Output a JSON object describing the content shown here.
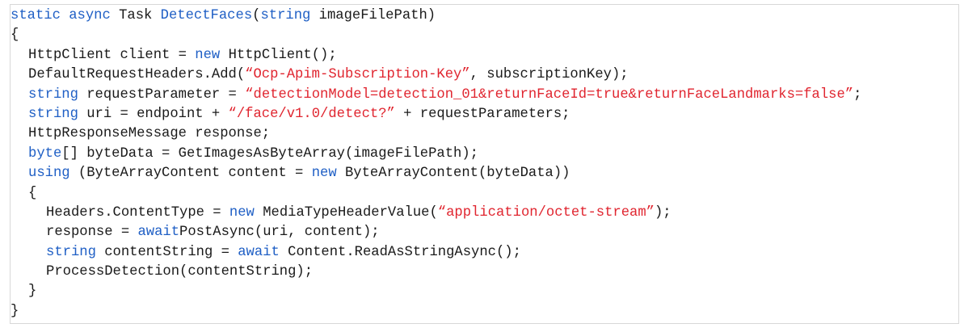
{
  "code": {
    "lines": [
      {
        "indent": 0,
        "tokens": [
          {
            "t": "static async ",
            "c": "kw"
          },
          {
            "t": "Task ",
            "c": "tx"
          },
          {
            "t": "DetectFaces",
            "c": "fn"
          },
          {
            "t": "(",
            "c": "tx"
          },
          {
            "t": "string",
            "c": "kw"
          },
          {
            "t": " imageFilePath)",
            "c": "tx"
          }
        ]
      },
      {
        "indent": 0,
        "tokens": [
          {
            "t": "{",
            "c": "tx"
          }
        ]
      },
      {
        "indent": 1,
        "tokens": [
          {
            "t": "HttpClient client = ",
            "c": "tx"
          },
          {
            "t": "new",
            "c": "kw"
          },
          {
            "t": " HttpClient();",
            "c": "tx"
          }
        ]
      },
      {
        "indent": 1,
        "tokens": [
          {
            "t": "DefaultRequestHeaders.Add(",
            "c": "tx"
          },
          {
            "t": "“Ocp-Apim-Subscription-Key”",
            "c": "str"
          },
          {
            "t": ", subscriptionKey);",
            "c": "tx"
          }
        ]
      },
      {
        "indent": 1,
        "tokens": [
          {
            "t": "string",
            "c": "kw"
          },
          {
            "t": " requestParameter = ",
            "c": "tx"
          },
          {
            "t": "“detectionModel=detection_01&returnFaceId=true&returnFaceLandmarks=false”",
            "c": "str"
          },
          {
            "t": ";",
            "c": "tx"
          }
        ]
      },
      {
        "indent": 1,
        "tokens": [
          {
            "t": "string",
            "c": "kw"
          },
          {
            "t": " uri = endpoint + ",
            "c": "tx"
          },
          {
            "t": "“/face/v1.0/detect?”",
            "c": "str"
          },
          {
            "t": " + requestParameters;",
            "c": "tx"
          }
        ]
      },
      {
        "indent": 1,
        "tokens": [
          {
            "t": "HttpResponseMessage response;",
            "c": "tx"
          }
        ]
      },
      {
        "indent": 1,
        "tokens": [
          {
            "t": "byte",
            "c": "kw"
          },
          {
            "t": "[] byteData = GetImagesAsByteArray(imageFilePath);",
            "c": "tx"
          }
        ]
      },
      {
        "indent": 1,
        "tokens": [
          {
            "t": "using",
            "c": "kw"
          },
          {
            "t": " (ByteArrayContent content = ",
            "c": "tx"
          },
          {
            "t": "new",
            "c": "kw"
          },
          {
            "t": " ByteArrayContent(byteData))",
            "c": "tx"
          }
        ]
      },
      {
        "indent": 1,
        "tokens": [
          {
            "t": "{",
            "c": "tx"
          }
        ]
      },
      {
        "indent": 2,
        "tokens": [
          {
            "t": "Headers.ContentType = ",
            "c": "tx"
          },
          {
            "t": "new",
            "c": "kw"
          },
          {
            "t": " MediaTypeHeaderValue(",
            "c": "tx"
          },
          {
            "t": "“application/octet-stream”",
            "c": "str"
          },
          {
            "t": ");",
            "c": "tx"
          }
        ]
      },
      {
        "indent": 2,
        "tokens": [
          {
            "t": "response = ",
            "c": "tx"
          },
          {
            "t": "await",
            "c": "kw"
          },
          {
            "t": "PostAsync(uri, content);",
            "c": "tx"
          }
        ]
      },
      {
        "indent": 2,
        "tokens": [
          {
            "t": "string",
            "c": "kw"
          },
          {
            "t": " contentString = ",
            "c": "tx"
          },
          {
            "t": "await",
            "c": "kw"
          },
          {
            "t": " Content.ReadAsStringAsync();",
            "c": "tx"
          }
        ]
      },
      {
        "indent": 2,
        "tokens": [
          {
            "t": "ProcessDetection(contentString);",
            "c": "tx"
          }
        ]
      },
      {
        "indent": 1,
        "tokens": [
          {
            "t": "}",
            "c": "tx"
          }
        ]
      },
      {
        "indent": 0,
        "tokens": [
          {
            "t": "}",
            "c": "tx"
          }
        ]
      }
    ],
    "colors": {
      "keyword": "#1f5fc5",
      "string": "#e0252f",
      "text": "#1a1a1a"
    }
  }
}
